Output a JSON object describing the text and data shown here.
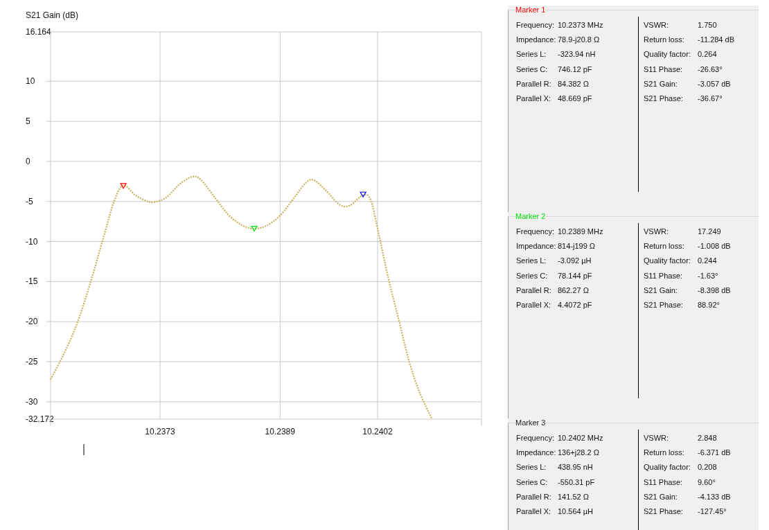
{
  "chart": {
    "chart_data": {
      "type": "line",
      "ylabel": "S21 Gain (dB)",
      "xlim": [
        10.235841,
        10.241585
      ],
      "ylim": [
        -32.172,
        16.164
      ],
      "grid": true,
      "yticks": [
        {
          "value": 16.164,
          "label": "16.164"
        },
        10,
        5,
        0,
        -5,
        -10,
        -15,
        -20,
        -25,
        -30,
        {
          "value": -32.172,
          "label": "-32.172"
        }
      ],
      "xticks": [
        10.2373,
        10.2389,
        10.2402
      ],
      "x": [
        10.235841,
        10.235998,
        10.236183,
        10.236367,
        10.236552,
        10.236691,
        10.236811,
        10.236968,
        10.237106,
        10.237217,
        10.237383,
        10.237568,
        10.237734,
        10.237845,
        10.23803,
        10.238215,
        10.238399,
        10.238556,
        10.238723,
        10.238907,
        10.239092,
        10.239231,
        10.239341,
        10.239508,
        10.239693,
        10.239831,
        10.240007,
        10.240108,
        10.2402,
        10.240339,
        10.240478,
        10.240616,
        10.240754,
        10.240921
      ],
      "series": [
        {
          "color": "#c4b25a",
          "line_style": "dotted",
          "values": [
            -27.2,
            -24.4,
            -20.5,
            -15.3,
            -9.3,
            -4.9,
            -3.0,
            -4.2,
            -4.9,
            -5.1,
            -4.5,
            -2.8,
            -1.9,
            -2.3,
            -4.5,
            -6.7,
            -8.0,
            -8.4,
            -8.0,
            -6.7,
            -4.5,
            -2.8,
            -2.3,
            -3.6,
            -5.4,
            -5.5,
            -4.2,
            -4.8,
            -8.4,
            -14.4,
            -19.6,
            -24.8,
            -28.7,
            -32.1
          ]
        },
        {
          "color": "#ff0000",
          "marker": "triangle",
          "values": [
            null,
            null,
            null,
            null,
            null,
            null,
            -3.057,
            null,
            null,
            null,
            null,
            null,
            null,
            null,
            null,
            null,
            null,
            null,
            null,
            null,
            null,
            null,
            null,
            null,
            null,
            null,
            null,
            null,
            null,
            null,
            null,
            null,
            null,
            null
          ]
        },
        {
          "color": "#00e000",
          "marker": "triangle",
          "values": [
            null,
            null,
            null,
            null,
            null,
            null,
            null,
            null,
            null,
            null,
            null,
            null,
            null,
            null,
            null,
            null,
            null,
            -8.398,
            null,
            null,
            null,
            null,
            null,
            null,
            null,
            null,
            null,
            null,
            null,
            null,
            null,
            null,
            null,
            null
          ]
        },
        {
          "color": "#0000ff",
          "marker": "triangle",
          "values": [
            null,
            null,
            null,
            null,
            null,
            null,
            null,
            null,
            null,
            null,
            null,
            null,
            null,
            null,
            null,
            null,
            null,
            null,
            null,
            null,
            null,
            null,
            null,
            null,
            null,
            null,
            -4.133,
            null,
            null,
            null,
            null,
            null,
            null,
            null
          ]
        }
      ]
    }
  },
  "markers": [
    {
      "title": "Marker 1",
      "color": "#ff0000",
      "left": [
        {
          "label": "Frequency:",
          "value": "10.2373 MHz"
        },
        {
          "label": "Impedance:",
          "value": "78.9-j20.8 Ω"
        },
        {
          "label": "Series L:",
          "value": "-323.94 nH"
        },
        {
          "label": "Series C:",
          "value": "746.12 pF"
        },
        {
          "label": "Parallel R:",
          "value": "84.382 Ω"
        },
        {
          "label": "Parallel X:",
          "value": "48.669 pF"
        }
      ],
      "right": [
        {
          "label": "VSWR:",
          "value": "1.750"
        },
        {
          "label": "Return loss:",
          "value": "-11.284 dB"
        },
        {
          "label": "Quality factor:",
          "value": "0.264"
        },
        {
          "label": "S11 Phase:",
          "value": "-26.63°"
        },
        {
          "label": "S21 Gain:",
          "value": "-3.057 dB"
        },
        {
          "label": "S21 Phase:",
          "value": "-36.67°"
        }
      ]
    },
    {
      "title": "Marker 2",
      "color": "#00e000",
      "left": [
        {
          "label": "Frequency:",
          "value": "10.2389 MHz"
        },
        {
          "label": "Impedance:",
          "value": "814-j199 Ω"
        },
        {
          "label": "Series L:",
          "value": "-3.092 µH"
        },
        {
          "label": "Series C:",
          "value": "78.144 pF"
        },
        {
          "label": "Parallel R:",
          "value": "862.27 Ω"
        },
        {
          "label": "Parallel X:",
          "value": "4.4072 pF"
        }
      ],
      "right": [
        {
          "label": "VSWR:",
          "value": "17.249"
        },
        {
          "label": "Return loss:",
          "value": "-1.008 dB"
        },
        {
          "label": "Quality factor:",
          "value": "0.244"
        },
        {
          "label": "S11 Phase:",
          "value": "-1.63°"
        },
        {
          "label": "S21 Gain:",
          "value": "-8.398 dB"
        },
        {
          "label": "S21 Phase:",
          "value": "88.92°"
        }
      ]
    },
    {
      "title": "Marker 3",
      "color": "#222222",
      "left": [
        {
          "label": "Frequency:",
          "value": "10.2402 MHz"
        },
        {
          "label": "Impedance:",
          "value": "136+j28.2 Ω"
        },
        {
          "label": "Series L:",
          "value": "438.95 nH"
        },
        {
          "label": "Series C:",
          "value": "-550.31 pF"
        },
        {
          "label": "Parallel R:",
          "value": "141.52 Ω"
        },
        {
          "label": "Parallel X:",
          "value": "10.564 µH"
        }
      ],
      "right": [
        {
          "label": "VSWR:",
          "value": "2.848"
        },
        {
          "label": "Return loss:",
          "value": "-6.371 dB"
        },
        {
          "label": "Quality factor:",
          "value": "0.208"
        },
        {
          "label": "S11 Phase:",
          "value": "9.60°"
        },
        {
          "label": "S21 Gain:",
          "value": "-4.133 dB"
        },
        {
          "label": "S21 Phase:",
          "value": "-127.45°"
        }
      ]
    }
  ]
}
